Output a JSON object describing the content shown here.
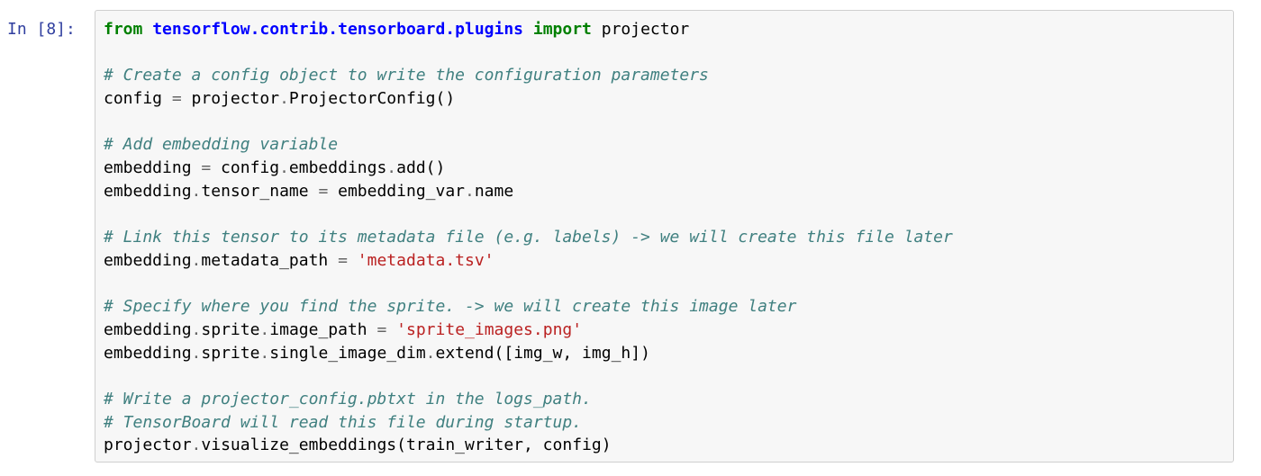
{
  "cell": {
    "prompt": "In [8]:",
    "lines": [
      {
        "segments": [
          {
            "t": "from",
            "c": "kw"
          },
          {
            "t": " ",
            "c": ""
          },
          {
            "t": "tensorflow.contrib.tensorboard.plugins",
            "c": "ns"
          },
          {
            "t": " ",
            "c": ""
          },
          {
            "t": "import",
            "c": "kw"
          },
          {
            "t": " projector",
            "c": ""
          }
        ]
      },
      {
        "segments": []
      },
      {
        "segments": [
          {
            "t": "# Create a config object to write the configuration parameters",
            "c": "cm"
          }
        ]
      },
      {
        "segments": [
          {
            "t": "config ",
            "c": ""
          },
          {
            "t": "=",
            "c": "op"
          },
          {
            "t": " projector",
            "c": ""
          },
          {
            "t": ".",
            "c": "op"
          },
          {
            "t": "ProjectorConfig()",
            "c": ""
          }
        ]
      },
      {
        "segments": []
      },
      {
        "segments": [
          {
            "t": "# Add embedding variable",
            "c": "cm"
          }
        ]
      },
      {
        "segments": [
          {
            "t": "embedding ",
            "c": ""
          },
          {
            "t": "=",
            "c": "op"
          },
          {
            "t": " config",
            "c": ""
          },
          {
            "t": ".",
            "c": "op"
          },
          {
            "t": "embeddings",
            "c": ""
          },
          {
            "t": ".",
            "c": "op"
          },
          {
            "t": "add()",
            "c": ""
          }
        ]
      },
      {
        "segments": [
          {
            "t": "embedding",
            "c": ""
          },
          {
            "t": ".",
            "c": "op"
          },
          {
            "t": "tensor_name ",
            "c": ""
          },
          {
            "t": "=",
            "c": "op"
          },
          {
            "t": " embedding_var",
            "c": ""
          },
          {
            "t": ".",
            "c": "op"
          },
          {
            "t": "name",
            "c": ""
          }
        ]
      },
      {
        "segments": []
      },
      {
        "segments": [
          {
            "t": "# Link this tensor to its metadata file (e.g. labels) -> we will create this file later",
            "c": "cm"
          }
        ]
      },
      {
        "segments": [
          {
            "t": "embedding",
            "c": ""
          },
          {
            "t": ".",
            "c": "op"
          },
          {
            "t": "metadata_path ",
            "c": ""
          },
          {
            "t": "=",
            "c": "op"
          },
          {
            "t": " ",
            "c": ""
          },
          {
            "t": "'metadata.tsv'",
            "c": "st"
          }
        ]
      },
      {
        "segments": []
      },
      {
        "segments": [
          {
            "t": "# Specify where you find the sprite. -> we will create this image later",
            "c": "cm"
          }
        ]
      },
      {
        "segments": [
          {
            "t": "embedding",
            "c": ""
          },
          {
            "t": ".",
            "c": "op"
          },
          {
            "t": "sprite",
            "c": ""
          },
          {
            "t": ".",
            "c": "op"
          },
          {
            "t": "image_path ",
            "c": ""
          },
          {
            "t": "=",
            "c": "op"
          },
          {
            "t": " ",
            "c": ""
          },
          {
            "t": "'sprite_images.png'",
            "c": "st"
          }
        ]
      },
      {
        "segments": [
          {
            "t": "embedding",
            "c": ""
          },
          {
            "t": ".",
            "c": "op"
          },
          {
            "t": "sprite",
            "c": ""
          },
          {
            "t": ".",
            "c": "op"
          },
          {
            "t": "single_image_dim",
            "c": ""
          },
          {
            "t": ".",
            "c": "op"
          },
          {
            "t": "extend([img_w, img_h])",
            "c": ""
          }
        ]
      },
      {
        "segments": []
      },
      {
        "segments": [
          {
            "t": "# Write a projector_config.pbtxt in the logs_path.",
            "c": "cm"
          }
        ]
      },
      {
        "segments": [
          {
            "t": "# TensorBoard will read this file during startup.",
            "c": "cm"
          }
        ]
      },
      {
        "segments": [
          {
            "t": "projector",
            "c": ""
          },
          {
            "t": ".",
            "c": "op"
          },
          {
            "t": "visualize_embeddings(train_writer, config)",
            "c": ""
          }
        ]
      }
    ]
  }
}
